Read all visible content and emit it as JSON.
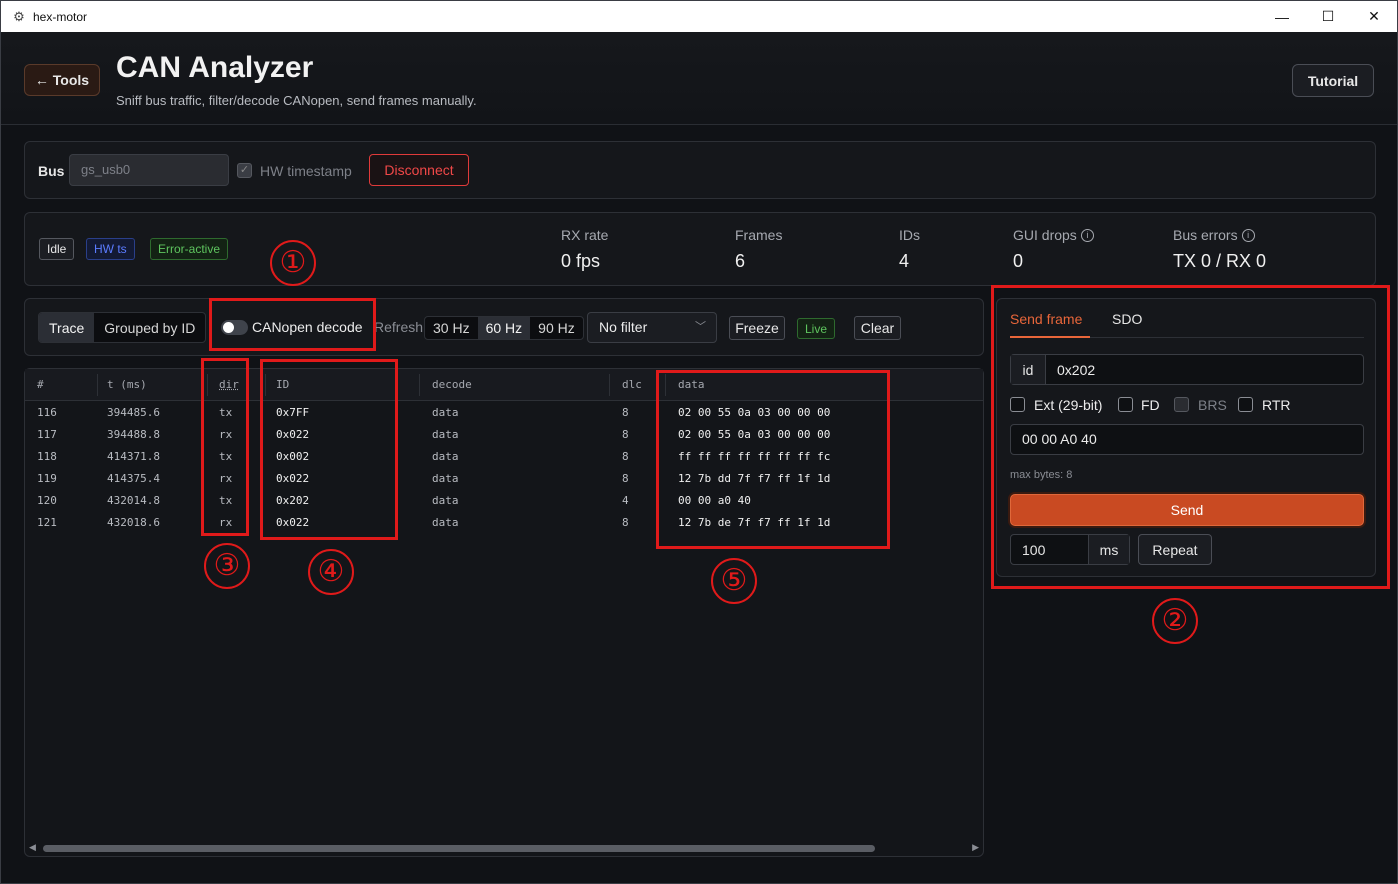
{
  "window": {
    "title": "hex-motor",
    "minimize": "—",
    "maximize": "☐",
    "close": "✕"
  },
  "header": {
    "back_label": "← Tools",
    "title": "CAN Analyzer",
    "subtitle": "Sniff bus traffic, filter/decode CANopen, send frames manually.",
    "tutorial_label": "Tutorial"
  },
  "bus": {
    "label": "Bus",
    "interface": "gs_usb0",
    "hw_timestamp_label": "HW timestamp",
    "disconnect_label": "Disconnect"
  },
  "status": {
    "badges": {
      "state": "Idle",
      "hw": "HW ts",
      "error": "Error-active"
    },
    "stats": [
      {
        "label": "RX rate",
        "value": "0 fps"
      },
      {
        "label": "Frames",
        "value": "6"
      },
      {
        "label": "IDs",
        "value": "4"
      },
      {
        "label": "GUI drops",
        "value": "0"
      },
      {
        "label": "Bus errors",
        "value": "TX 0 / RX 0"
      }
    ]
  },
  "toolbar": {
    "view_trace": "Trace",
    "view_grouped": "Grouped by ID",
    "canopen_label": "CANopen decode",
    "refresh_label": "Refresh",
    "rates": [
      "30 Hz",
      "60 Hz",
      "90 Hz"
    ],
    "rate_selected": "60 Hz",
    "filter_value": "No filter",
    "freeze_label": "Freeze",
    "live_label": "Live",
    "clear_label": "Clear"
  },
  "table": {
    "columns": [
      "#",
      "t (ms)",
      "dir",
      "ID",
      "decode",
      "dlc",
      "data"
    ],
    "rows": [
      [
        "116",
        "394485.6",
        "tx",
        "0x7FF",
        "data",
        "8",
        "02 00 55 0a 03 00 00 00"
      ],
      [
        "117",
        "394488.8",
        "rx",
        "0x022",
        "data",
        "8",
        "02 00 55 0a 03 00 00 00"
      ],
      [
        "118",
        "414371.8",
        "tx",
        "0x002",
        "data",
        "8",
        "ff ff ff ff ff ff ff fc"
      ],
      [
        "119",
        "414375.4",
        "rx",
        "0x022",
        "data",
        "8",
        "12 7b dd 7f f7 ff 1f 1d"
      ],
      [
        "120",
        "432014.8",
        "tx",
        "0x202",
        "data",
        "4",
        "00 00 a0 40"
      ],
      [
        "121",
        "432018.6",
        "rx",
        "0x022",
        "data",
        "8",
        "12 7b de 7f f7 ff 1f 1d"
      ]
    ]
  },
  "send": {
    "tab_send": "Send frame",
    "tab_sdo": "SDO",
    "id_prefix": "id",
    "id_value": "0x202",
    "flags": [
      "Ext (29-bit)",
      "FD",
      "BRS",
      "RTR"
    ],
    "data_value": "00 00 A0 40",
    "max_bytes": "max bytes: 8",
    "send_label": "Send",
    "period_value": "100",
    "period_unit": "ms",
    "repeat_label": "Repeat"
  },
  "annotations": [
    "①",
    "②",
    "③",
    "④",
    "⑤"
  ],
  "colors": {
    "accent": "#e8663a",
    "danger": "#e01a1a",
    "live": "#5ec45e",
    "hw": "#5b7bff"
  }
}
